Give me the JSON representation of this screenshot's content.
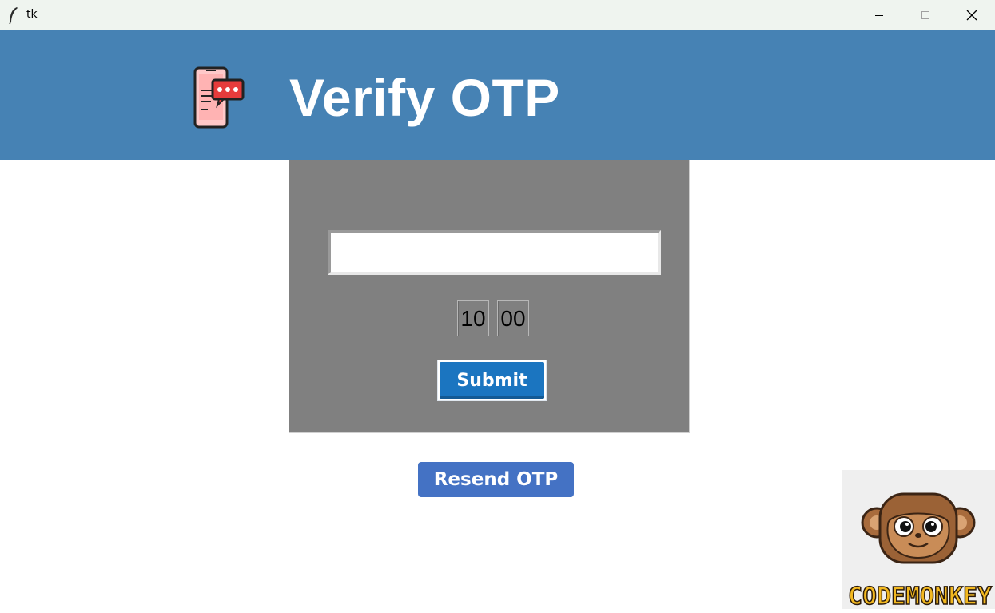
{
  "window": {
    "title": "tk",
    "controls": {
      "minimize": "minimize",
      "maximize": "maximize",
      "close": "close"
    }
  },
  "header": {
    "icon": "phone-otp-icon",
    "title": "Verify OTP",
    "background": "#4682b4"
  },
  "form": {
    "otp_value": "",
    "otp_placeholder": "",
    "timer": {
      "minutes": "10",
      "seconds": "00"
    },
    "submit_label": "Submit",
    "card_background": "#808080",
    "submit_color": "#1b75c0"
  },
  "resend": {
    "label": "Resend OTP",
    "color": "#4472c4"
  },
  "logo": {
    "name": "codemonkey-logo",
    "text": "CODEMONKEY"
  }
}
